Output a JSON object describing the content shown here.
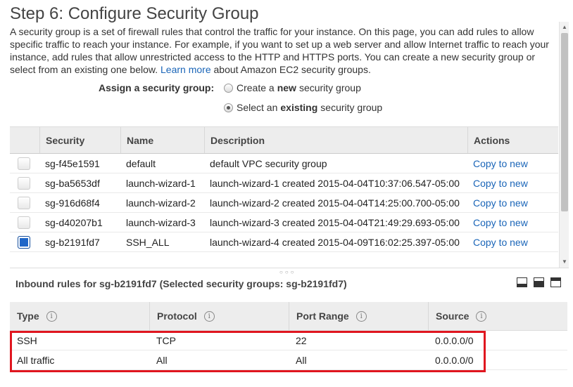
{
  "page": {
    "title": "Step 6: Configure Security Group",
    "intro_text": "A security group is a set of firewall rules that control the traffic for your instance. On this page, you can add rules to allow specific traffic to reach your instance. For example, if you want to set up a web server and allow Internet traffic to reach your instance, add rules that allow unrestricted access to the HTTP and HTTPS ports. You can create a new security group or select from an existing one below.",
    "learn_more": "Learn more",
    "intro_suffix": "about Amazon EC2 security groups."
  },
  "assign": {
    "label": "Assign a security group:",
    "options": [
      {
        "prefix": "Create a",
        "bold": "new",
        "suffix": "security group",
        "selected": false
      },
      {
        "prefix": "Select an",
        "bold": "existing",
        "suffix": "security group",
        "selected": true
      }
    ]
  },
  "sg_table": {
    "headers": [
      "",
      "Security",
      "Name",
      "Description",
      "Actions"
    ],
    "rows": [
      {
        "checked": false,
        "id": "sg-f45e1591",
        "name": "default",
        "description": "default VPC security group",
        "action": "Copy to new"
      },
      {
        "checked": false,
        "id": "sg-ba5653df",
        "name": "launch-wizard-1",
        "description": "launch-wizard-1 created 2015-04-04T10:37:06.547-05:00",
        "action": "Copy to new"
      },
      {
        "checked": false,
        "id": "sg-916d68f4",
        "name": "launch-wizard-2",
        "description": "launch-wizard-2 created 2015-04-04T14:25:00.700-05:00",
        "action": "Copy to new"
      },
      {
        "checked": false,
        "id": "sg-d40207b1",
        "name": "launch-wizard-3",
        "description": "launch-wizard-3 created 2015-04-04T21:49:29.693-05:00",
        "action": "Copy to new"
      },
      {
        "checked": true,
        "id": "sg-b2191fd7",
        "name": "SSH_ALL",
        "description": "launch-wizard-4 created 2015-04-09T16:02:25.397-05:00",
        "action": "Copy to new"
      }
    ]
  },
  "inbound": {
    "title": "Inbound rules for sg-b2191fd7 (Selected security groups: sg-b2191fd7)",
    "info_glyph": "i",
    "headers": [
      "Type",
      "Protocol",
      "Port Range",
      "Source"
    ],
    "rows": [
      [
        "SSH",
        "TCP",
        "22",
        "0.0.0.0/0"
      ],
      [
        "All traffic",
        "All",
        "All",
        "0.0.0.0/0"
      ]
    ]
  },
  "icons": {
    "scroll_up": "▲",
    "scroll_down": "▼",
    "grip": "○○○"
  },
  "colors": {
    "link": "#1a65b8",
    "highlight": "#e0161f",
    "checkbox_selected": "#1f66c8"
  }
}
